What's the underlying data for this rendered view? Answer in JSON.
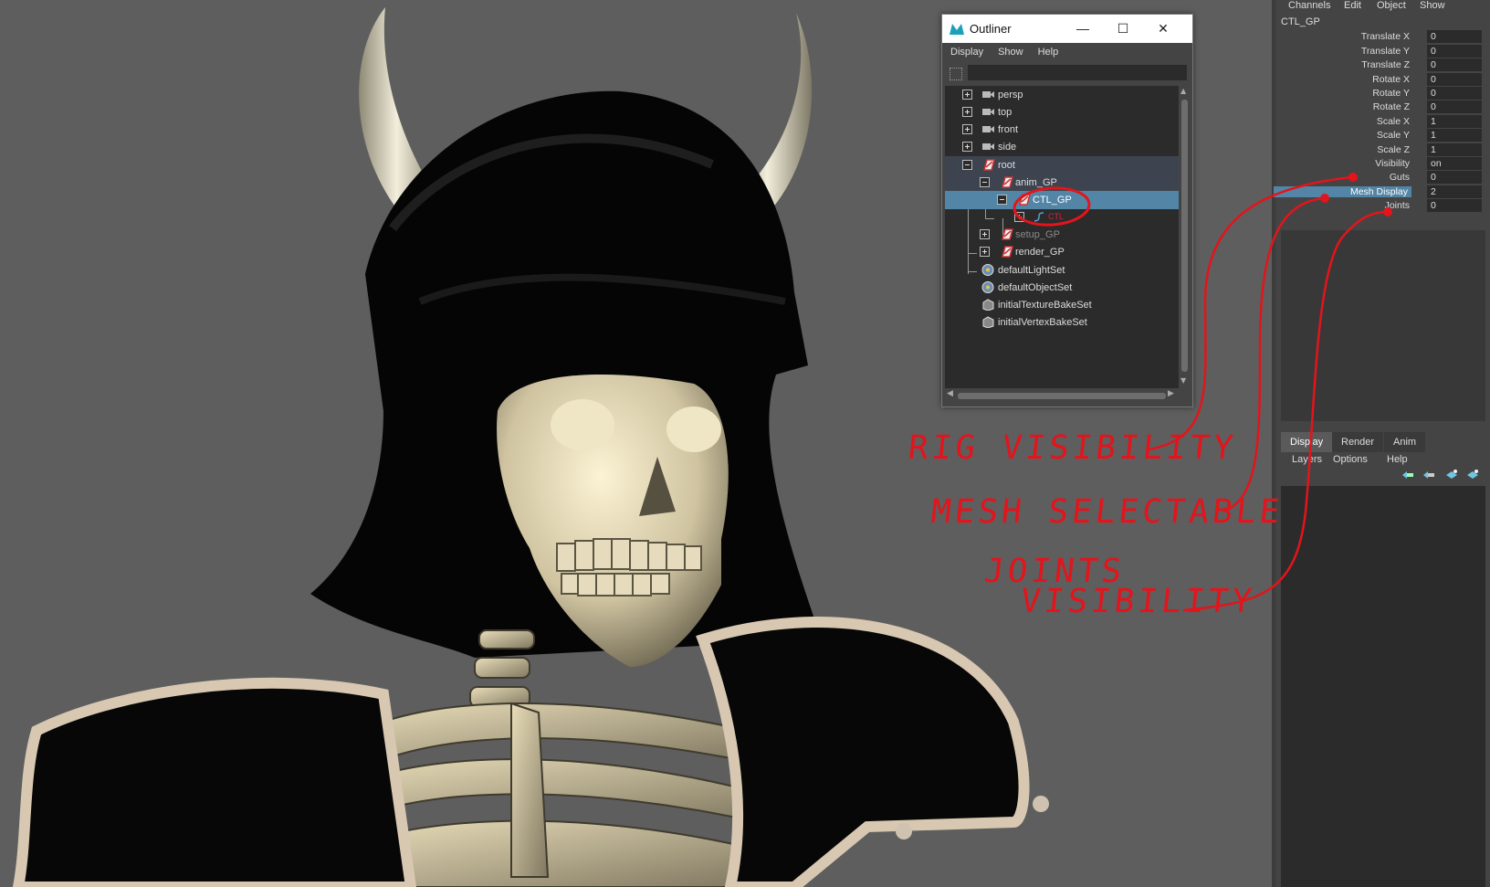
{
  "outliner": {
    "title": "Outliner",
    "menu": [
      "Display",
      "Show",
      "Help"
    ],
    "search_value": "",
    "items": [
      {
        "label": "persp",
        "type": "camera"
      },
      {
        "label": "top",
        "type": "camera"
      },
      {
        "label": "front",
        "type": "camera"
      },
      {
        "label": "side",
        "type": "camera"
      },
      {
        "label": "root",
        "type": "group"
      },
      {
        "label": "anim_GP",
        "type": "group"
      },
      {
        "label": "CTL_GP",
        "type": "group"
      },
      {
        "label": "CTL",
        "type": "curve"
      },
      {
        "label": "setup_GP",
        "type": "group"
      },
      {
        "label": "render_GP",
        "type": "group"
      },
      {
        "label": "defaultLightSet",
        "type": "set"
      },
      {
        "label": "defaultObjectSet",
        "type": "set"
      },
      {
        "label": "initialTextureBakeSet",
        "type": "bakeset"
      },
      {
        "label": "initialVertexBakeSet",
        "type": "bakeset"
      }
    ],
    "selected": "CTL_GP"
  },
  "channel_box": {
    "menu": [
      "Channels",
      "Edit",
      "Object",
      "Show"
    ],
    "object": "CTL_GP",
    "attributes": [
      {
        "name": "Translate X",
        "value": "0"
      },
      {
        "name": "Translate Y",
        "value": "0"
      },
      {
        "name": "Translate Z",
        "value": "0"
      },
      {
        "name": "Rotate X",
        "value": "0"
      },
      {
        "name": "Rotate Y",
        "value": "0"
      },
      {
        "name": "Rotate Z",
        "value": "0"
      },
      {
        "name": "Scale X",
        "value": "1"
      },
      {
        "name": "Scale Y",
        "value": "1"
      },
      {
        "name": "Scale Z",
        "value": "1"
      },
      {
        "name": "Visibility",
        "value": "on"
      },
      {
        "name": "Guts",
        "value": "0"
      },
      {
        "name": "Mesh Display",
        "value": "2"
      },
      {
        "name": "Joints",
        "value": "0"
      }
    ],
    "highlighted_attribute": "Mesh Display"
  },
  "layer_editor": {
    "tabs": [
      "Display",
      "Render",
      "Anim"
    ],
    "active_tab": "Display",
    "menu": [
      "Layers",
      "Options",
      "Help"
    ]
  },
  "annotations": {
    "rig_visibility": "RIG VISIBILITY",
    "mesh_selectable": "MESH SELECTABLE",
    "joints_visibility_line1": "JOINTS",
    "joints_visibility_line2": "VISIBILITY",
    "color": "#e3141c"
  },
  "colors": {
    "viewport_bg": "#5e5e5e",
    "selection": "#5285a6",
    "panel_bg": "#444444",
    "field_bg": "#2b2b2b"
  }
}
